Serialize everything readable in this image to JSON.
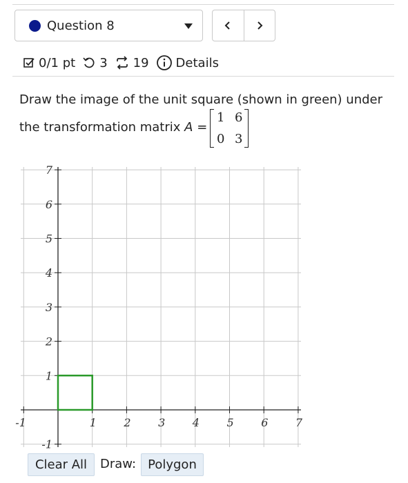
{
  "header": {
    "question_label": "Question 8",
    "prev_icon": "chevron-left-icon",
    "next_icon": "chevron-right-icon"
  },
  "meta": {
    "score": "0/1 pt",
    "retries": "3",
    "submissions": "19",
    "details": "Details"
  },
  "prompt": {
    "line1": "Draw the image of the unit square (shown in green) under",
    "line2_prefix": "the transformation matrix ",
    "variable": "A",
    "equals": " =",
    "matrix": [
      [
        "1",
        "6"
      ],
      [
        "0",
        "3"
      ]
    ]
  },
  "graph": {
    "x_ticks": [
      "-1",
      "1",
      "2",
      "3",
      "4",
      "5",
      "6",
      "7"
    ],
    "y_ticks": [
      "7",
      "6",
      "5",
      "4",
      "3",
      "2",
      "1",
      "-1"
    ],
    "x_range": [
      -1,
      7
    ],
    "y_range": [
      -1,
      7
    ],
    "unit_square": [
      [
        0,
        0
      ],
      [
        1,
        0
      ],
      [
        1,
        1
      ],
      [
        0,
        1
      ]
    ],
    "square_color": "#2a9a2a"
  },
  "controls": {
    "clear_all": "Clear All",
    "draw_label": "Draw:",
    "polygon": "Polygon"
  },
  "colors": {
    "question_dot": "#0b1a8c",
    "button_bg": "#e6eef6"
  }
}
